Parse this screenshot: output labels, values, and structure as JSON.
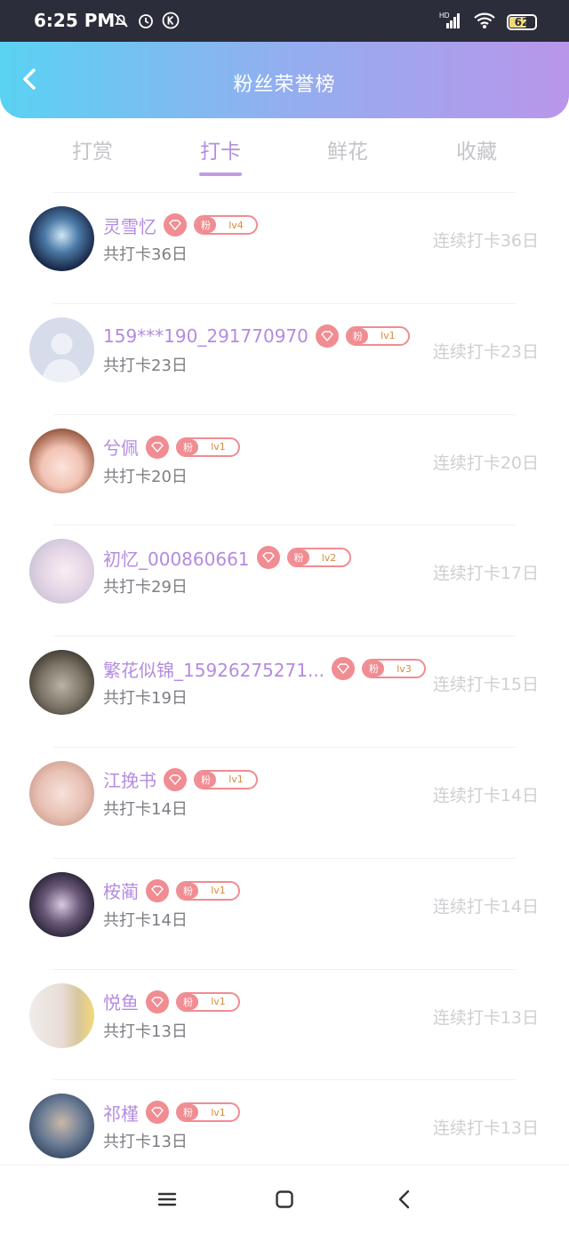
{
  "status_bar": {
    "time": "6:25 PM",
    "battery": "62",
    "network": "HD"
  },
  "header": {
    "title": "粉丝荣誉榜"
  },
  "tabs": [
    {
      "label": "打赏",
      "active": false
    },
    {
      "label": "打卡",
      "active": true
    },
    {
      "label": "鲜花",
      "active": false
    },
    {
      "label": "收藏",
      "active": false
    }
  ],
  "rows": [
    {
      "name": "灵雪忆",
      "fan_label": "粉",
      "level": "lv4",
      "total": "共打卡36日",
      "streak": "连续打卡36日"
    },
    {
      "name": "159***190_291770970",
      "fan_label": "粉",
      "level": "lv1",
      "total": "共打卡23日",
      "streak": "连续打卡23日"
    },
    {
      "name": "兮佩",
      "fan_label": "粉",
      "level": "lv1",
      "total": "共打卡20日",
      "streak": "连续打卡20日"
    },
    {
      "name": "初忆_000860661",
      "fan_label": "粉",
      "level": "lv2",
      "total": "共打卡29日",
      "streak": "连续打卡17日"
    },
    {
      "name": "繁花似锦_15926275271...",
      "fan_label": "粉",
      "level": "lv3",
      "total": "共打卡19日",
      "streak": "连续打卡15日"
    },
    {
      "name": "江挽书",
      "fan_label": "粉",
      "level": "lv1",
      "total": "共打卡14日",
      "streak": "连续打卡14日"
    },
    {
      "name": "桉蔺",
      "fan_label": "粉",
      "level": "lv1",
      "total": "共打卡14日",
      "streak": "连续打卡14日"
    },
    {
      "name": "悦鱼",
      "fan_label": "粉",
      "level": "lv1",
      "total": "共打卡13日",
      "streak": "连续打卡13日"
    },
    {
      "name": "祁槿",
      "fan_label": "粉",
      "level": "lv1",
      "total": "共打卡13日",
      "streak": "连续打卡13日"
    }
  ],
  "colors": {
    "accent": "#b48be0",
    "badge": "#f08c92",
    "header_start": "#5ad2f2",
    "header_end": "#b996ea"
  }
}
